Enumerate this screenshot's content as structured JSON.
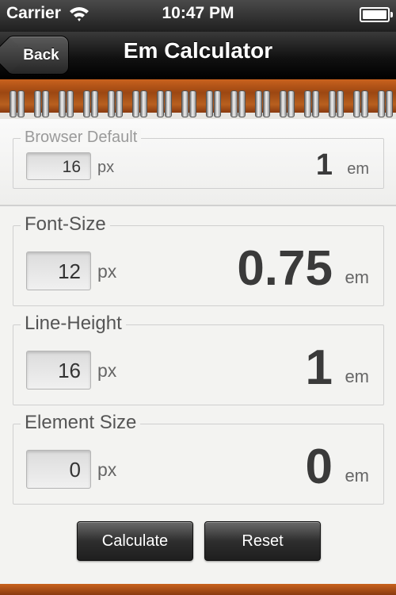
{
  "status_bar": {
    "carrier": "Carrier",
    "time": "10:47 PM"
  },
  "nav": {
    "back_label": "Back",
    "title": "Em Calculator"
  },
  "browser_default": {
    "legend": "Browser Default",
    "px_value": "16",
    "px_unit": "px",
    "em_value": "1",
    "em_unit": "em"
  },
  "font_size": {
    "legend": "Font-Size",
    "px_value": "12",
    "px_unit": "px",
    "em_value": "0.75",
    "em_unit": "em"
  },
  "line_height": {
    "legend": "Line-Height",
    "px_value": "16",
    "px_unit": "px",
    "em_value": "1",
    "em_unit": "em"
  },
  "element_size": {
    "legend": "Element Size",
    "px_value": "0",
    "px_unit": "px",
    "em_value": "0",
    "em_unit": "em"
  },
  "actions": {
    "calculate_label": "Calculate",
    "reset_label": "Reset"
  },
  "icons": {
    "wifi": "wifi-icon",
    "battery": "battery-icon",
    "back_arrow": "chevron-left-icon"
  }
}
